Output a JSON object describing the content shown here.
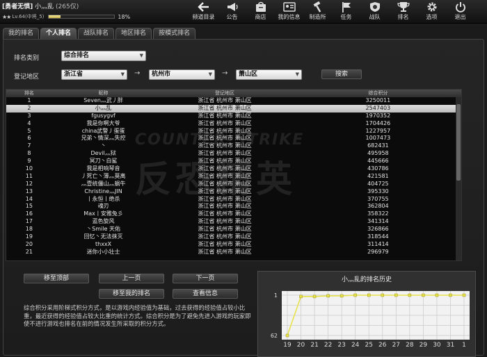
{
  "player": {
    "clan_tag": "[勇者无惧]",
    "name": "小灬乱",
    "kd": "(265仅)",
    "level_text": "Lv.64(中将_5)",
    "exp_percent": 18,
    "exp_text": "18%"
  },
  "topnav": [
    {
      "label": "频道目录",
      "icon": "back-arrow-icon"
    },
    {
      "label": "公告",
      "icon": "megaphone-icon"
    },
    {
      "label": "商店",
      "icon": "shop-icon"
    },
    {
      "label": "我的信息",
      "icon": "profile-card-icon"
    },
    {
      "label": "制造所",
      "icon": "hammer-icon"
    },
    {
      "label": "任务",
      "icon": "flag-icon"
    },
    {
      "label": "战队",
      "icon": "shield-icon"
    },
    {
      "label": "排名",
      "icon": "trophy-icon"
    },
    {
      "label": "选项",
      "icon": "gear-icon"
    },
    {
      "label": "退出",
      "icon": "power-icon"
    }
  ],
  "tabs": [
    "我的排名",
    "个人排名",
    "战队排名",
    "地区排名",
    "按模式排名"
  ],
  "active_tab": 1,
  "filters": {
    "type_label": "排名类别",
    "type_value": "综合排名",
    "region_label": "登记地区",
    "province": "浙江省",
    "city": "杭州市",
    "district": "萧山区",
    "arrow": "→",
    "search": "搜索"
  },
  "table": {
    "headers": [
      "排名",
      "昵称",
      "登记地区",
      "综合积分"
    ],
    "selected_index": 1,
    "rows": [
      {
        "rank": "1",
        "name": "Seven灬武丿胖",
        "region": "浙江省  杭州市  萧山区",
        "score": "3250011"
      },
      {
        "rank": "2",
        "name": "小灬乱",
        "region": "浙江省  杭州市  萧山区",
        "score": "2547403"
      },
      {
        "rank": "3",
        "name": "fgusygvf",
        "region": "浙江省  杭州市  萧山区",
        "score": "1970352"
      },
      {
        "rank": "4",
        "name": "我是你啊大爷",
        "region": "浙江省  杭州市  萧山区",
        "score": "1704426"
      },
      {
        "rank": "5",
        "name": "china武警丿蛋蛋",
        "region": "浙江省  杭州市  萧山区",
        "score": "1227957"
      },
      {
        "rank": "6",
        "name": "兄弟丶情深灬失控",
        "region": "浙江省  杭州市  萧山区",
        "score": "1007473"
      },
      {
        "rank": "7",
        "name": "丶",
        "region": "浙江省  杭州市  萧山区",
        "score": "682431"
      },
      {
        "rank": "8",
        "name": "Devil灬狱",
        "region": "浙江省  杭州市  萧山区",
        "score": "495958"
      },
      {
        "rank": "9",
        "name": "冥刀丶白鲨",
        "region": "浙江省  杭州市  萧山区",
        "score": "445666"
      },
      {
        "rank": "10",
        "name": "我是相响琴音",
        "region": "浙江省  杭州市  萧山区",
        "score": "430786"
      },
      {
        "rank": "11",
        "name": "丿死亡丶薄灬莫离",
        "region": "浙江省  杭州市  萧山区",
        "score": "421581"
      },
      {
        "rank": "12",
        "name": "灬壹统僵山灬蜗牛",
        "region": "浙江省  杭州市  萧山区",
        "score": "404725"
      },
      {
        "rank": "13",
        "name": "Christine灬JIN",
        "region": "浙江省  杭州市  萧山区",
        "score": "395330"
      },
      {
        "rank": "14",
        "name": "丨永恒丨绝杀",
        "region": "浙江省  杭州市  萧山区",
        "score": "370755"
      },
      {
        "rank": "15",
        "name": "魂刃",
        "region": "浙江省  杭州市  萧山区",
        "score": "362804"
      },
      {
        "rank": "16",
        "name": "Max丨安雅兔彡",
        "region": "浙江省  杭州市  萧山区",
        "score": "358322"
      },
      {
        "rank": "17",
        "name": "蓝色旋风",
        "region": "浙江省  杭州市  萧山区",
        "score": "341314"
      },
      {
        "rank": "18",
        "name": "丶Smile     天佑",
        "region": "浙江省  杭州市  萧山区",
        "score": "326866"
      },
      {
        "rank": "19",
        "name": "回忆丶无法抹灭",
        "region": "浙江省  杭州市  萧山区",
        "score": "318544"
      },
      {
        "rank": "20",
        "name": "thxxX",
        "region": "浙江省  杭州市  萧山区",
        "score": "311414"
      },
      {
        "rank": "21",
        "name": "迷你小小壮士",
        "region": "浙江省  杭州市  萧山区",
        "score": "296979"
      }
    ]
  },
  "watermark": {
    "line1": "COUNTER-STRIKE ONLINE",
    "line2": "反恐精英"
  },
  "buttons": {
    "top": "移至顶部",
    "prev": "上一页",
    "next": "下一页",
    "mine": "移至我的排名",
    "info": "查看信息"
  },
  "description": "综合积分采用阶梯式积分方式，是以游戏内经验值为基础，过去获得的经验值占较小比重，最近获得的经验值占较大比重的统计方式。综合积分是为了避免先进入游戏的玩家即使不进行游戏也排名在前的情况发生所采取的积分方式。",
  "chart_data": {
    "type": "line",
    "title": "小灬乱的排名历史",
    "x": [
      "19",
      "20",
      "21",
      "22",
      "23",
      "24",
      "25",
      "26",
      "27",
      "28",
      "29",
      "30",
      "31",
      "1"
    ],
    "y_tick_labels": [
      "1",
      "62"
    ],
    "series": [
      {
        "values": [
          62,
          3,
          3,
          2,
          2,
          1,
          1,
          1,
          1,
          1,
          1,
          1,
          1,
          1
        ]
      }
    ],
    "ylim": [
      62,
      1
    ],
    "line_color": "#e8e24a",
    "grid": true
  },
  "colors": {
    "accent": "#e8e24a",
    "selected_row": "#d0d0d0"
  }
}
